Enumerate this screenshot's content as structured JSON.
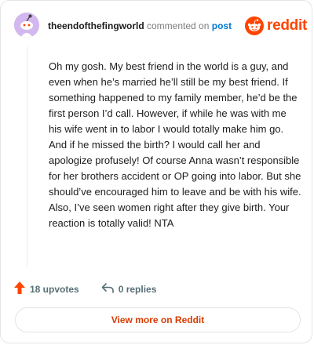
{
  "header": {
    "username": "theendofthefingworld",
    "action_text": "commented on",
    "post_link": "post",
    "brand": "reddit"
  },
  "comment": {
    "body": "Oh my gosh. My best friend in the world is a guy, and even when he’s married he’ll still be my best friend. If something happened to my family member, he’d be the first person I’d call. However, if while he was with me his wife went in to labor I would totally make him go. And if he missed the birth? I would call her and apologize profusely! Of course Anna wasn’t responsible for her brothers accident or OP going into labor. But she should’ve encouraged him to leave and be with his wife. Also, I’ve seen women right after they give birth. Your reaction is totally valid! NTA"
  },
  "footer": {
    "upvotes": "18 upvotes",
    "replies": "0 replies",
    "view_more": "View more on Reddit"
  },
  "colors": {
    "brand_orange": "#ff4500",
    "link_blue": "#0079d3",
    "avatar_bg": "#d2b8ef",
    "cta_text": "#d93a00"
  },
  "icons": [
    "avatar",
    "reddit-logo-icon",
    "upvote-arrow-icon",
    "reply-icon"
  ]
}
